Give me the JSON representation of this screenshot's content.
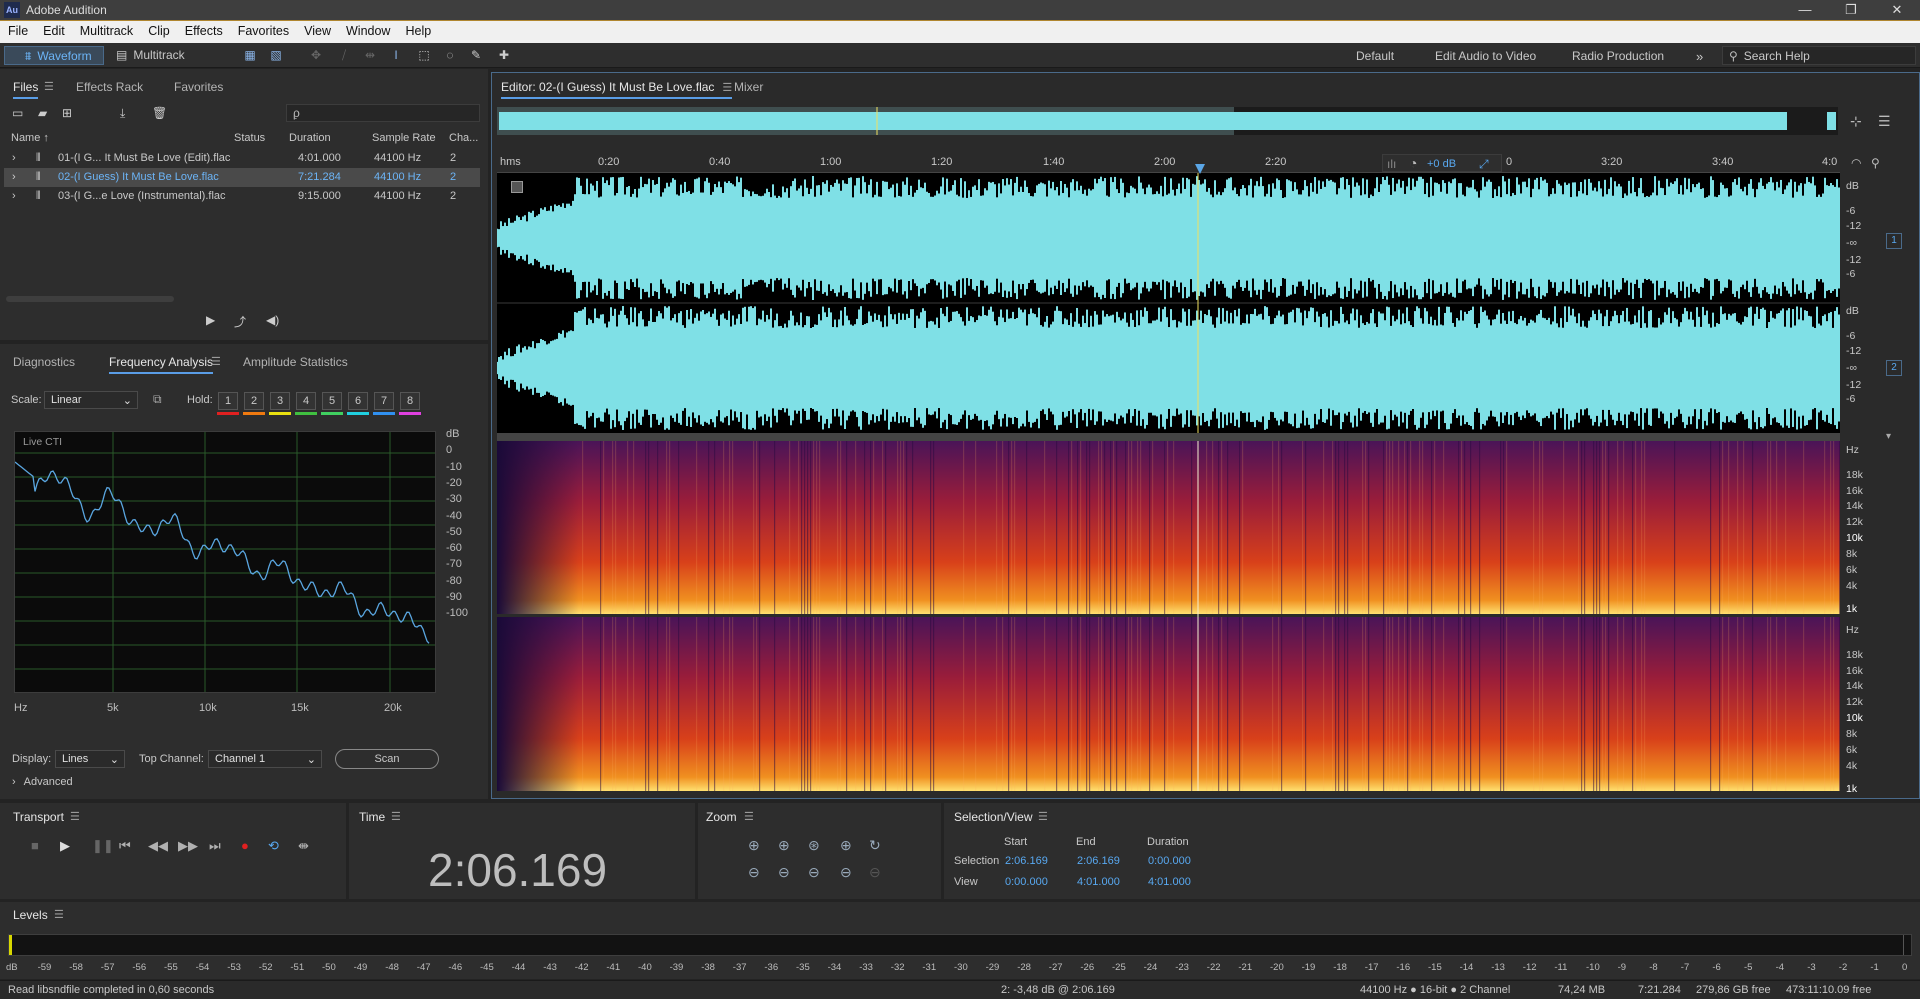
{
  "app": {
    "logo": "Au",
    "title": "Adobe Audition"
  },
  "window_controls": {
    "minimize": "—",
    "maximize": "❐",
    "close": "✕"
  },
  "menu": [
    "File",
    "Edit",
    "Multitrack",
    "Clip",
    "Effects",
    "Favorites",
    "View",
    "Window",
    "Help"
  ],
  "toolbar": {
    "waveform_label": "Waveform",
    "multitrack_label": "Multitrack",
    "workspaces": [
      "Default",
      "Edit Audio to Video",
      "Radio Production"
    ],
    "more": "»",
    "search_placeholder": "Search Help"
  },
  "files_panel": {
    "tabs": [
      "Files",
      "Effects Rack",
      "Favorites"
    ],
    "columns": [
      "Name ↑",
      "Status",
      "Duration",
      "Sample Rate",
      "Cha..."
    ],
    "rows": [
      {
        "name": "01-(I G... It Must Be Love (Edit).flac",
        "status": "",
        "duration": "4:01.000",
        "rate": "44100 Hz",
        "channels": "2"
      },
      {
        "name": "02-(I Guess) It Must Be Love.flac",
        "status": "",
        "duration": "7:21.284",
        "rate": "44100 Hz",
        "channels": "2"
      },
      {
        "name": "03-(I G...e Love (Instrumental).flac",
        "status": "",
        "duration": "9:15.000",
        "rate": "44100 Hz",
        "channels": "2"
      }
    ],
    "search_placeholder": "ρ̣"
  },
  "analysis_panel": {
    "tabs": [
      "Diagnostics",
      "Frequency Analysis",
      "Amplitude Statistics"
    ],
    "scale_label": "Scale:",
    "scale_value": "Linear",
    "hold_label": "Hold:",
    "hold": [
      "1",
      "2",
      "3",
      "4",
      "5",
      "6",
      "7",
      "8"
    ],
    "hold_colors": [
      "#e02020",
      "#f07a10",
      "#e8e010",
      "#40c040",
      "#40d060",
      "#20d0e0",
      "#3090f0",
      "#e040e0"
    ],
    "graph_label": "Live CTI",
    "db_labels": [
      "dB",
      "0",
      "-10",
      "-20",
      "-30",
      "-40",
      "-50",
      "-60",
      "-70",
      "-80",
      "-90",
      "-100"
    ],
    "hz_labels": [
      "Hz",
      "5k",
      "10k",
      "15k",
      "20k"
    ],
    "display_label": "Display:",
    "display_value": "Lines",
    "top_channel_label": "Top Channel:",
    "top_channel_value": "Channel 1",
    "scan_label": "Scan",
    "advanced_label": "Advanced"
  },
  "editor": {
    "tab": "Editor: 02-(I Guess) It Must Be Love.flac",
    "mixer_tab": "Mixer",
    "ruler_unit": "hms",
    "ruler": [
      "0:20",
      "0:40",
      "1:00",
      "1:20",
      "1:40",
      "2:00",
      "2:20",
      "3:20",
      "3:40",
      "4:0"
    ],
    "ruler_partial": "0",
    "hud_db": "+0 dB",
    "amp_labels": [
      "dB",
      "-6",
      "-12",
      "-∞",
      "-12",
      "-6"
    ],
    "channels": [
      "1",
      "2"
    ],
    "freq_labels": [
      "Hz",
      "18k",
      "16k",
      "14k",
      "12k",
      "10k",
      "8k",
      "6k",
      "4k",
      "1k"
    ],
    "waveform_color": "#7fe0e6",
    "playhead_color": "#f0e060"
  },
  "transport": {
    "title": "Transport"
  },
  "time": {
    "title": "Time",
    "value": "2:06.169"
  },
  "zoom": {
    "title": "Zoom"
  },
  "selection_view": {
    "title": "Selection/View",
    "headers": [
      "Start",
      "End",
      "Duration"
    ],
    "rows": [
      {
        "label": "Selection",
        "start": "2:06.169",
        "end": "2:06.169",
        "duration": "0:00.000"
      },
      {
        "label": "View",
        "start": "0:00.000",
        "end": "4:01.000",
        "duration": "4:01.000"
      }
    ]
  },
  "levels": {
    "title": "Levels",
    "scale": [
      "dB",
      "-59",
      "-58",
      "-57",
      "-56",
      "-55",
      "-54",
      "-53",
      "-52",
      "-51",
      "-50",
      "-49",
      "-48",
      "-47",
      "-46",
      "-45",
      "-44",
      "-43",
      "-42",
      "-41",
      "-40",
      "-39",
      "-38",
      "-37",
      "-36",
      "-35",
      "-34",
      "-33",
      "-32",
      "-31",
      "-30",
      "-29",
      "-28",
      "-27",
      "-26",
      "-25",
      "-24",
      "-23",
      "-22",
      "-21",
      "-20",
      "-19",
      "-18",
      "-17",
      "-16",
      "-15",
      "-14",
      "-13",
      "-12",
      "-11",
      "-10",
      "-9",
      "-8",
      "-7",
      "-6",
      "-5",
      "-4",
      "-3",
      "-2",
      "-1",
      "0"
    ]
  },
  "status": {
    "message": "Read libsndfile completed in 0,60 seconds",
    "cursor": "2: -3,48 dB @ 2:06.169",
    "format": "44100 Hz ● 16-bit ● 2 Channel",
    "size": "74,24 MB",
    "duration": "7:21.284",
    "free": "279,86 GB free",
    "free_time": "473:11:10.09 free"
  }
}
